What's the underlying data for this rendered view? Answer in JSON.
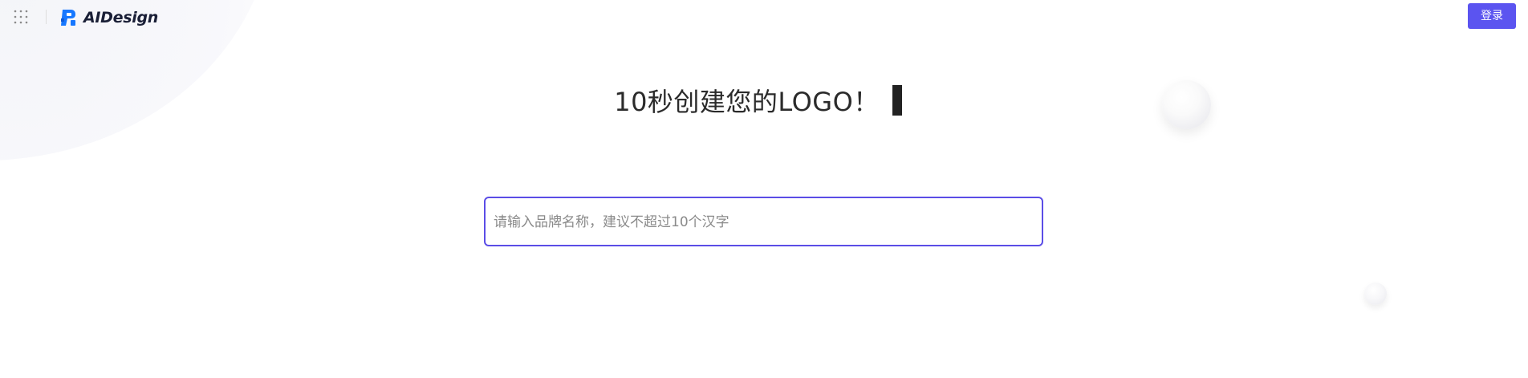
{
  "header": {
    "apps_icon": "grid-dots-icon",
    "logo_text": "AIDesign",
    "login_label": "登录"
  },
  "main": {
    "headline": "10秒创建您的LOGO！",
    "search": {
      "placeholder": "请输入品牌名称，建议不超过10个汉字",
      "value": ""
    }
  },
  "colors": {
    "accent": "#5b54f0",
    "input_border": "#5b4de6",
    "headline_text": "#2b2b2b",
    "logo_blue": "#1677ff"
  }
}
